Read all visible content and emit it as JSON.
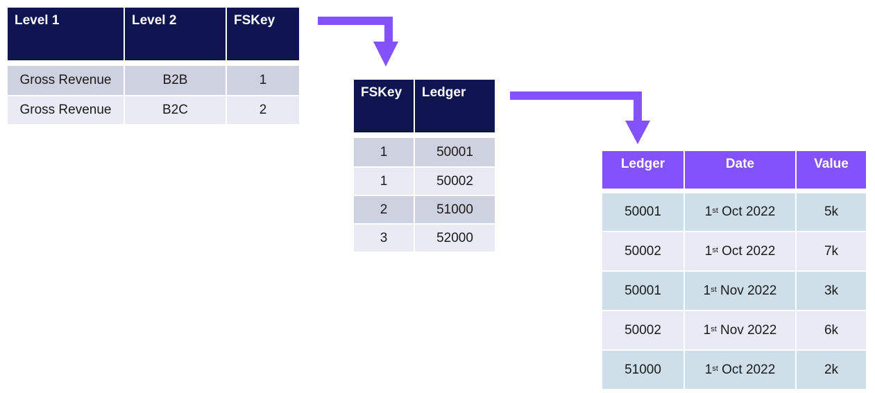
{
  "colors": {
    "navy_header": "#0e1550",
    "purple_header": "#8452fb",
    "arrow": "#8452fb",
    "row_dark_grey": "#ced1e0",
    "row_light_grey": "#e9eaf4",
    "row_blue": "#cfdfea",
    "row_lavender": "#e9eaf6"
  },
  "table1": {
    "headers": [
      "Level 1",
      "Level 2",
      "FSKey"
    ],
    "rows": [
      [
        "Gross Revenue",
        "B2B",
        "1"
      ],
      [
        "Gross Revenue",
        "B2C",
        "2"
      ]
    ]
  },
  "table2": {
    "headers": [
      "FSKey",
      "Ledger"
    ],
    "rows": [
      [
        "1",
        "50001"
      ],
      [
        "1",
        "50002"
      ],
      [
        "2",
        "51000"
      ],
      [
        "3",
        "52000"
      ]
    ]
  },
  "table3": {
    "headers": [
      "Ledger",
      "Date",
      "Value"
    ],
    "rows": [
      {
        "ledger": "50001",
        "day": "1",
        "suffix": "st",
        "month_year": "Oct 2022",
        "value": "5k"
      },
      {
        "ledger": "50002",
        "day": "1",
        "suffix": "st",
        "month_year": "Oct 2022",
        "value": "7k"
      },
      {
        "ledger": "50001",
        "day": "1",
        "suffix": "st",
        "month_year": "Nov 2022",
        "value": "3k"
      },
      {
        "ledger": "50002",
        "day": "1",
        "suffix": "st",
        "month_year": "Nov 2022",
        "value": "6k"
      },
      {
        "ledger": "51000",
        "day": "1",
        "suffix": "st",
        "month_year": "Oct 2022",
        "value": "2k"
      }
    ]
  },
  "arrows": [
    {
      "from": "table1",
      "to": "table2",
      "icon": "elbow-arrow-down-icon"
    },
    {
      "from": "table2",
      "to": "table3",
      "icon": "elbow-arrow-down-icon"
    }
  ]
}
